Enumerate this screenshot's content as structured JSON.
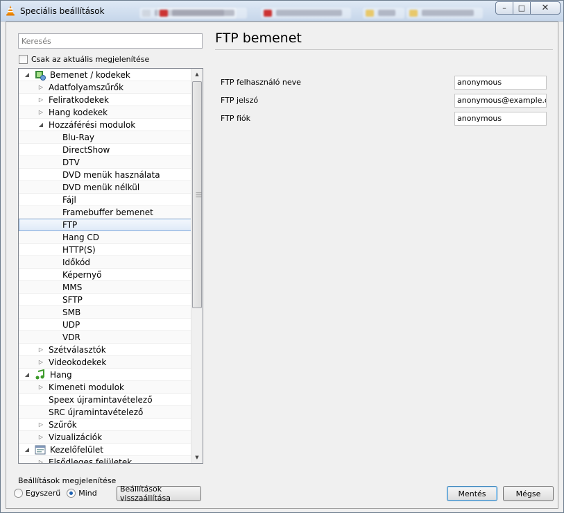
{
  "window": {
    "title": "Speciális beállítások"
  },
  "search": {
    "placeholder": "Keresés"
  },
  "show_current_only": {
    "label": "Csak az aktuális megjelenítése",
    "checked": false
  },
  "tree": {
    "items": [
      {
        "label": "Bemenet / kodekek",
        "level": 0,
        "expander": "expanded",
        "icon": "input-codecs-icon"
      },
      {
        "label": "Adatfolyamszűrők",
        "level": 1,
        "expander": "collapsed"
      },
      {
        "label": "Feliratkodekek",
        "level": 1,
        "expander": "collapsed"
      },
      {
        "label": "Hang kodekek",
        "level": 1,
        "expander": "collapsed"
      },
      {
        "label": "Hozzáférési modulok",
        "level": 1,
        "expander": "expanded"
      },
      {
        "label": "Blu-Ray",
        "level": 2,
        "expander": "none"
      },
      {
        "label": "DirectShow",
        "level": 2,
        "expander": "none"
      },
      {
        "label": "DTV",
        "level": 2,
        "expander": "none"
      },
      {
        "label": "DVD menük használata",
        "level": 2,
        "expander": "none"
      },
      {
        "label": "DVD menük nélkül",
        "level": 2,
        "expander": "none"
      },
      {
        "label": "Fájl",
        "level": 2,
        "expander": "none"
      },
      {
        "label": "Framebuffer bemenet",
        "level": 2,
        "expander": "none"
      },
      {
        "label": "FTP",
        "level": 2,
        "expander": "none",
        "selected": true
      },
      {
        "label": "Hang CD",
        "level": 2,
        "expander": "none"
      },
      {
        "label": "HTTP(S)",
        "level": 2,
        "expander": "none"
      },
      {
        "label": "Időkód",
        "level": 2,
        "expander": "none"
      },
      {
        "label": "Képernyő",
        "level": 2,
        "expander": "none"
      },
      {
        "label": "MMS",
        "level": 2,
        "expander": "none"
      },
      {
        "label": "SFTP",
        "level": 2,
        "expander": "none"
      },
      {
        "label": "SMB",
        "level": 2,
        "expander": "none"
      },
      {
        "label": "UDP",
        "level": 2,
        "expander": "none"
      },
      {
        "label": "VDR",
        "level": 2,
        "expander": "none"
      },
      {
        "label": "Szétválasztók",
        "level": 1,
        "expander": "collapsed"
      },
      {
        "label": "Videokodekek",
        "level": 1,
        "expander": "collapsed"
      },
      {
        "label": "Hang",
        "level": 0,
        "expander": "expanded",
        "icon": "audio-note-icon"
      },
      {
        "label": "Kimeneti modulok",
        "level": 1,
        "expander": "collapsed"
      },
      {
        "label": "Speex újramintavételező",
        "level": 1,
        "expander": "none"
      },
      {
        "label": "SRC újramintavételező",
        "level": 1,
        "expander": "none"
      },
      {
        "label": "Szűrők",
        "level": 1,
        "expander": "collapsed"
      },
      {
        "label": "Vizualizációk",
        "level": 1,
        "expander": "collapsed"
      },
      {
        "label": "Kezelőfelület",
        "level": 0,
        "expander": "expanded",
        "icon": "interface-icon"
      },
      {
        "label": "Elsődleges felületek",
        "level": 1,
        "expander": "collapsed"
      }
    ]
  },
  "panel": {
    "title": "FTP bemenet",
    "fields": [
      {
        "label": "FTP felhasználó neve",
        "value": "anonymous"
      },
      {
        "label": "FTP jelszó",
        "value": "anonymous@example.com"
      },
      {
        "label": "FTP fiók",
        "value": "anonymous"
      }
    ]
  },
  "display_mode": {
    "label": "Beállítások megjelenítése",
    "options": [
      {
        "label": "Egyszerű",
        "selected": false
      },
      {
        "label": "Mind",
        "selected": true
      }
    ]
  },
  "buttons": {
    "reset": "Beállítások visszaállítása",
    "save": "Mentés",
    "cancel": "Mégse"
  },
  "colors": {
    "accent": "#84acdd",
    "selection_bg": "#dfeaf8",
    "vlc_orange": "#f08a00"
  }
}
